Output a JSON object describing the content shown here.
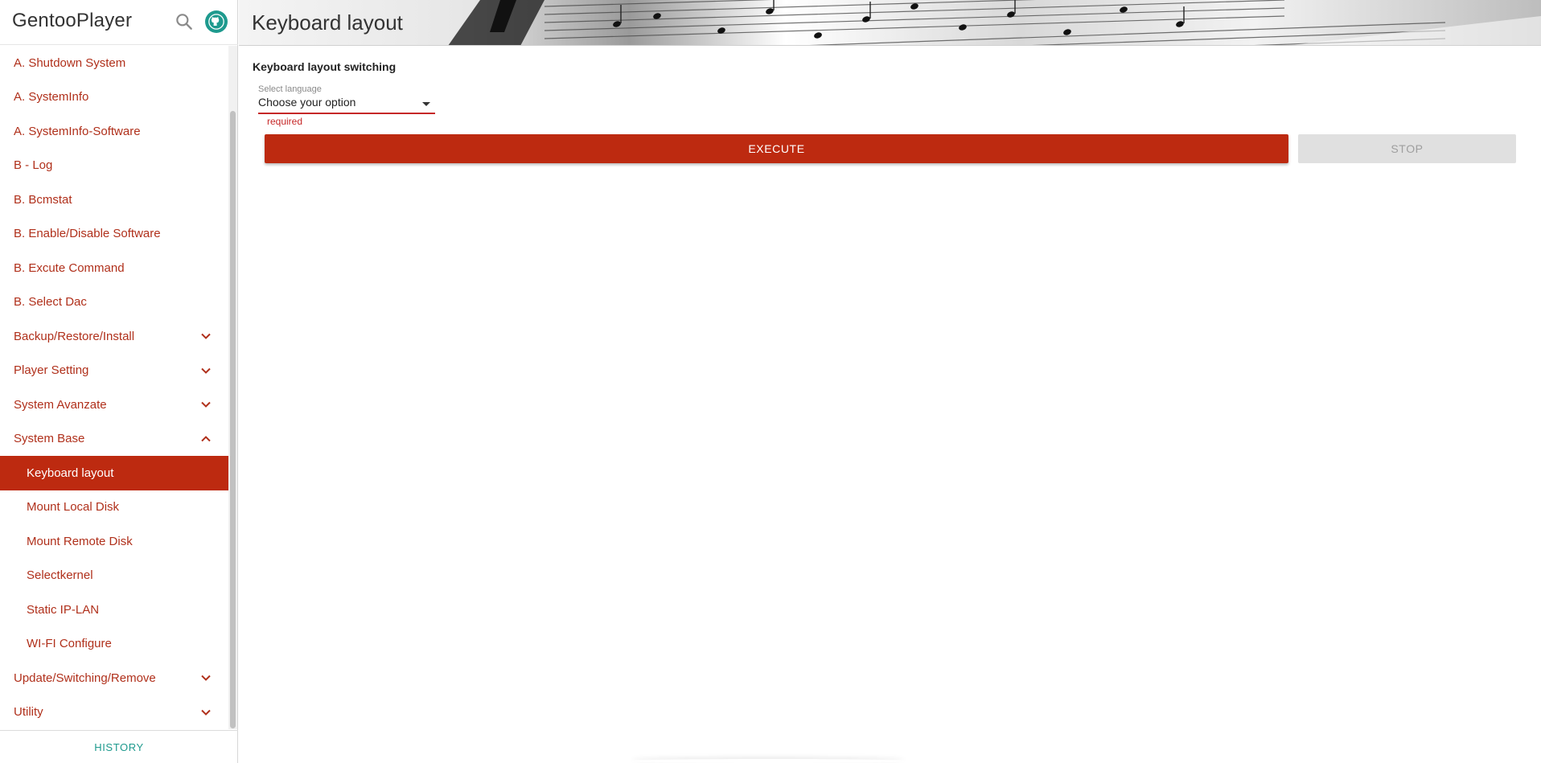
{
  "app": {
    "title": "GentooPlayer",
    "icons": {
      "search": "search-icon",
      "github": "github-icon"
    }
  },
  "sidebar": {
    "items": [
      {
        "label": "A. Shutdown System",
        "level": 0,
        "expandable": false
      },
      {
        "label": "A. SystemInfo",
        "level": 0,
        "expandable": false
      },
      {
        "label": "A. SystemInfo-Software",
        "level": 0,
        "expandable": false
      },
      {
        "label": "B - Log",
        "level": 0,
        "expandable": false
      },
      {
        "label": "B. Bcmstat",
        "level": 0,
        "expandable": false
      },
      {
        "label": "B. Enable/Disable Software",
        "level": 0,
        "expandable": false
      },
      {
        "label": "B. Excute Command",
        "level": 0,
        "expandable": false
      },
      {
        "label": "B. Select Dac",
        "level": 0,
        "expandable": false
      },
      {
        "label": "Backup/Restore/Install",
        "level": 0,
        "expandable": true,
        "expanded": false
      },
      {
        "label": "Player Setting",
        "level": 0,
        "expandable": true,
        "expanded": false
      },
      {
        "label": "System Avanzate",
        "level": 0,
        "expandable": true,
        "expanded": false
      },
      {
        "label": "System Base",
        "level": 0,
        "expandable": true,
        "expanded": true
      },
      {
        "label": "Keyboard layout",
        "level": 1,
        "expandable": false,
        "active": true
      },
      {
        "label": "Mount Local Disk",
        "level": 1,
        "expandable": false
      },
      {
        "label": "Mount Remote Disk",
        "level": 1,
        "expandable": false
      },
      {
        "label": "Selectkernel",
        "level": 1,
        "expandable": false
      },
      {
        "label": "Static IP-LAN",
        "level": 1,
        "expandable": false
      },
      {
        "label": "WI-FI Configure",
        "level": 1,
        "expandable": false
      },
      {
        "label": "Update/Switching/Remove",
        "level": 0,
        "expandable": true,
        "expanded": false
      },
      {
        "label": "Utility",
        "level": 0,
        "expandable": true,
        "expanded": false
      }
    ],
    "footer": {
      "history_label": "HISTORY"
    }
  },
  "main": {
    "page_title": "Keyboard layout",
    "section_title": "Keyboard layout switching",
    "select": {
      "label": "Select language",
      "value": "Choose your option",
      "helper": "required"
    },
    "buttons": {
      "execute_label": "EXECUTE",
      "stop_label": "STOP"
    }
  },
  "colors": {
    "accent": "#bd2a10",
    "nav_text": "#b0301b",
    "error": "#c62828",
    "teal": "#1e9a8e",
    "disabled_bg": "#e0e0e0",
    "disabled_text": "#9e9e9e"
  }
}
